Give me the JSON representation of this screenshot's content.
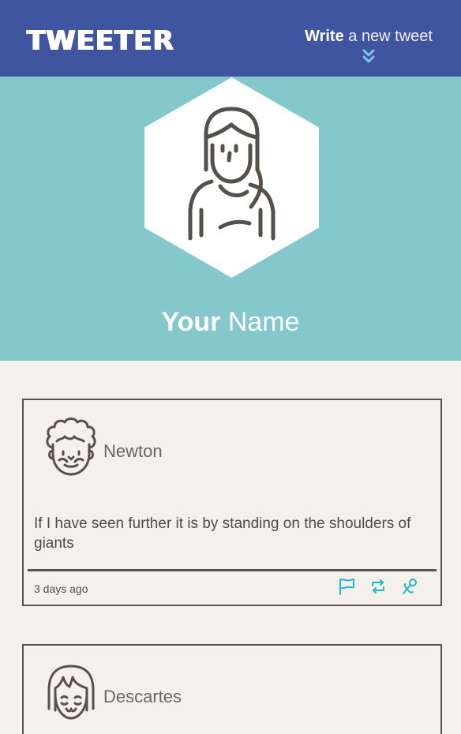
{
  "header": {
    "brand": "TWEETER",
    "compose_strong": "Write",
    "compose_rest": " a new tweet"
  },
  "profile": {
    "first_name": "Your",
    "last_name": " Name"
  },
  "tweets": [
    {
      "author": "Newton",
      "text": "If I have seen further it is by standing on the shoulders of giants",
      "time": "3 days ago",
      "actions": [
        "flag-icon",
        "retweet-icon",
        "heart-icon"
      ]
    },
    {
      "author": "Descartes"
    }
  ],
  "colors": {
    "nav": "#3f55a0",
    "banner": "#84c8cc",
    "background": "#f4f1ec",
    "ink": "#57524d",
    "accent": "#1fb8c9"
  }
}
